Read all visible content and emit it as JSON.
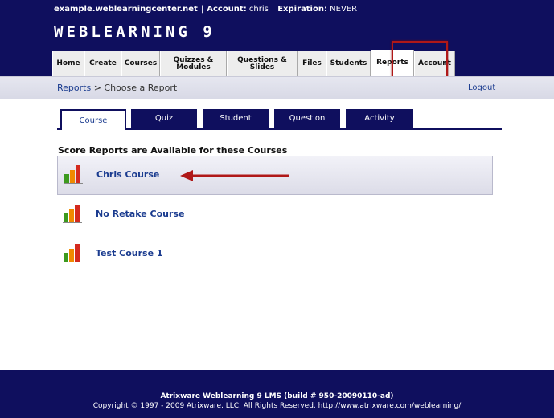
{
  "header": {
    "site": "example.weblearningcenter.net",
    "account_label": "Account:",
    "account_value": "chris",
    "expiration_label": "Expiration:",
    "expiration_value": "NEVER",
    "logo": "WEBLEARNING 9"
  },
  "nav": {
    "tabs": [
      {
        "label": "Home"
      },
      {
        "label": "Create"
      },
      {
        "label": "Courses"
      },
      {
        "label": "Quizzes &\nModules"
      },
      {
        "label": "Questions &\nSlides"
      },
      {
        "label": "Files"
      },
      {
        "label": "Students"
      },
      {
        "label": "Reports",
        "active": true
      },
      {
        "label": "Account"
      }
    ]
  },
  "breadcrumb": {
    "link": "Reports",
    "separator": ">",
    "current": "Choose a Report"
  },
  "logout": "Logout",
  "report_tabs": [
    {
      "label": "Course",
      "active": true
    },
    {
      "label": "Quiz"
    },
    {
      "label": "Student"
    },
    {
      "label": "Question"
    },
    {
      "label": "Activity"
    }
  ],
  "section_title": "Score Reports are Available for these Courses",
  "courses": [
    {
      "name": "Chris Course",
      "highlighted": true
    },
    {
      "name": "No Retake Course"
    },
    {
      "name": "Test Course 1"
    }
  ],
  "colors": {
    "brand_navy": "#0f0f5e",
    "link_blue": "#1a3b8f",
    "annotation_red": "#b01818",
    "bar_green": "#3c9a1e",
    "bar_orange": "#f08a00",
    "bar_red": "#d42a1e"
  },
  "icons": {
    "course_icon": "bar-chart-icon",
    "annotation": "red-arrow-pointer"
  },
  "footer": {
    "line1": "Atrixware Weblearning 9 LMS (build # 950-20090110-ad)",
    "line2": "Copyright © 1997 - 2009 Atrixware, LLC. All Rights Reserved. http://www.atrixware.com/weblearning/"
  }
}
